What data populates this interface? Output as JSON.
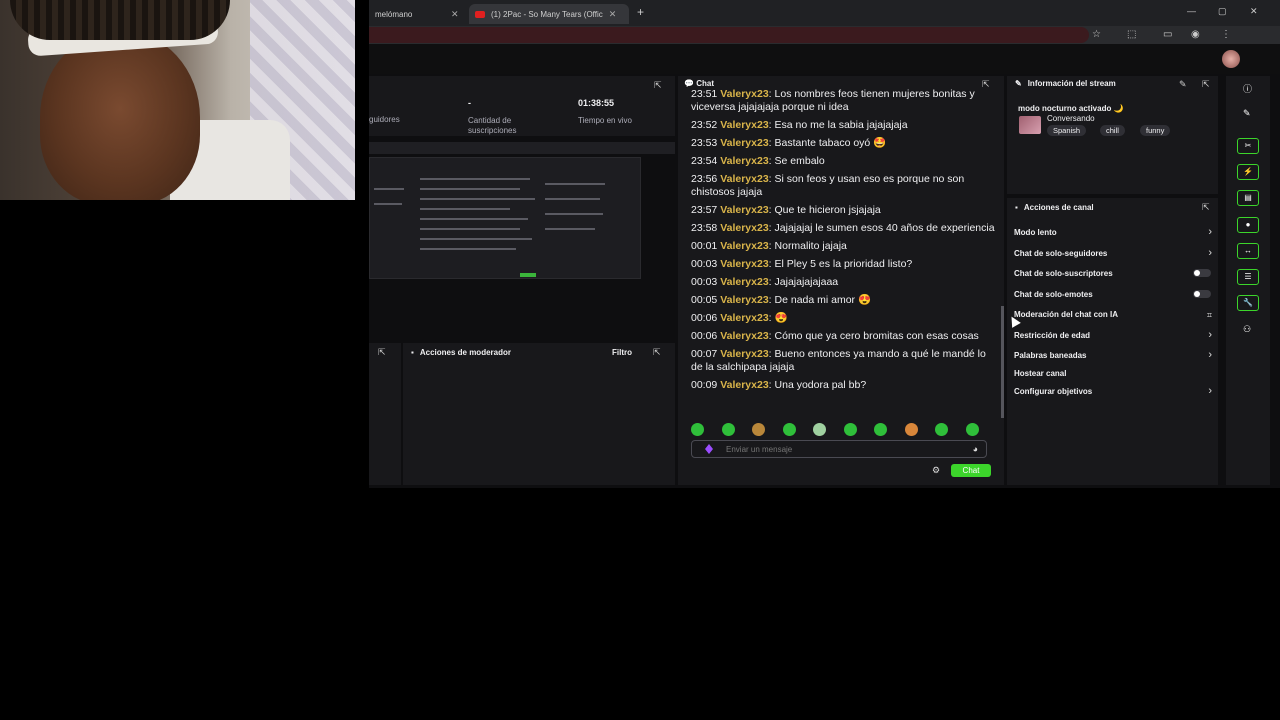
{
  "browser": {
    "tab1": "melómano",
    "tab2": "(1) 2Pac - So Many Tears (Offic"
  },
  "stats": {
    "followers_label": "guidores",
    "subs_value": "-",
    "subs_label": "Cantidad de suscripciones",
    "live_value": "01:38:55",
    "live_label": "Tiempo en vivo"
  },
  "moderator": {
    "title": "Acciones de moderador",
    "filter": "Filtro"
  },
  "chat": {
    "title": "Chat",
    "messages": [
      {
        "time": "23:51",
        "user": "Valeryx23",
        "text": "Los nombres feos tienen mujeres bonitas y viceversa jajajajaja porque ni idea"
      },
      {
        "time": "23:52",
        "user": "Valeryx23",
        "text": "Esa no me la sabia jajajajaja"
      },
      {
        "time": "23:53",
        "user": "Valeryx23",
        "text": "Bastante tabaco oyó 🤩"
      },
      {
        "time": "23:54",
        "user": "Valeryx23",
        "text": "Se embalo"
      },
      {
        "time": "23:56",
        "user": "Valeryx23",
        "text": "Si son feos y usan eso es porque no son chistosos jajaja"
      },
      {
        "time": "23:57",
        "user": "Valeryx23",
        "text": "Que te hicieron jsjajaja"
      },
      {
        "time": "23:58",
        "user": "Valeryx23",
        "text": "Jajajajaj le sumen esos 40 años de experiencia"
      },
      {
        "time": "00:01",
        "user": "Valeryx23",
        "text": "Normalito jajaja"
      },
      {
        "time": "00:03",
        "user": "Valeryx23",
        "text": "El Pley 5 es la prioridad listo?"
      },
      {
        "time": "00:03",
        "user": "Valeryx23",
        "text": "Jajajajajajaaa"
      },
      {
        "time": "00:05",
        "user": "Valeryx23",
        "text": "De nada mi amor 😍"
      },
      {
        "time": "00:06",
        "user": "Valeryx23",
        "text": "😍"
      },
      {
        "time": "00:06",
        "user": "Valeryx23",
        "text": "Cómo que ya cero bromitas con esas cosas"
      },
      {
        "time": "00:07",
        "user": "Valeryx23",
        "text": "Bueno entonces ya mando a qué le mandé lo de la salchipapa jajaja"
      },
      {
        "time": "00:09",
        "user": "Valeryx23",
        "text": "Una yodora pal bb?"
      }
    ],
    "input_placeholder": "Enviar un mensaje",
    "send_label": "Chat"
  },
  "stream_info": {
    "title": "Información del stream",
    "stream_title": "modo nocturno activado 🌙",
    "category": "Conversando",
    "tags": [
      "Spanish",
      "chill",
      "funny"
    ]
  },
  "channel_actions": {
    "title": "Acciones de canal",
    "items": [
      {
        "label": "Modo lento",
        "control": "chevron"
      },
      {
        "label": "Chat de solo-seguidores",
        "control": "chevron"
      },
      {
        "label": "Chat de solo-suscriptores",
        "control": "toggle"
      },
      {
        "label": "Chat de solo-emotes",
        "control": "toggle"
      },
      {
        "label": "Moderación del chat con IA",
        "control": "chart"
      },
      {
        "label": "Restricción de edad",
        "control": "chevron"
      },
      {
        "label": "Palabras baneadas",
        "control": "chevron"
      },
      {
        "label": "Hostear canal",
        "control": "none"
      },
      {
        "label": "Configurar objetivos",
        "control": "chevron"
      }
    ]
  },
  "colors": {
    "accent_green": "#3cd52b",
    "username": "#d9b44a"
  }
}
